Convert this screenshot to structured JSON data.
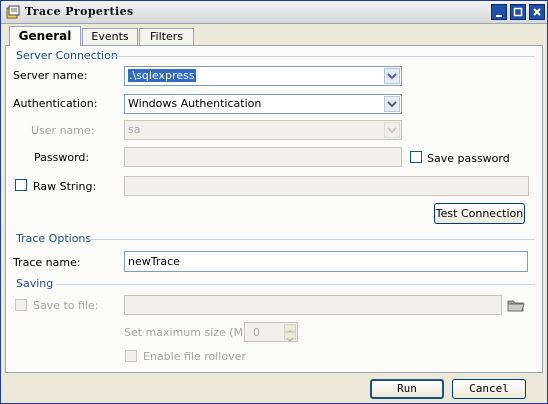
{
  "window": {
    "title": "Trace Properties"
  },
  "tabs": [
    {
      "label": "General",
      "active": true
    },
    {
      "label": "Events",
      "active": false
    },
    {
      "label": "Filters",
      "active": false
    }
  ],
  "server_connection": {
    "section": "Server Connection",
    "server_name_label": "Server name:",
    "server_name_value": ".\\sqlexpress",
    "auth_label": "Authentication:",
    "auth_value": "Windows Authentication",
    "user_label": "User name:",
    "user_value": "sa",
    "password_label": "Password:",
    "password_value": "",
    "save_password_label": "Save password",
    "raw_string_label": "Raw String:",
    "raw_string_value": "",
    "test_button": "Test Connection"
  },
  "trace_options": {
    "section": "Trace Options",
    "trace_name_label": "Trace name:",
    "trace_name_value": "newTrace"
  },
  "saving": {
    "section": "Saving",
    "save_to_file_label": "Save to file:",
    "file_value": "",
    "max_size_label": "Set maximum size (MB)",
    "max_size_value": "0",
    "rollover_label": "Enable file rollover"
  },
  "footer": {
    "run_button": "Run",
    "cancel_button": "Cancel"
  },
  "colors": {
    "section_text": "#1f4c9a",
    "selection": "#316ac5",
    "title_buttons": "#1f4fa8"
  }
}
